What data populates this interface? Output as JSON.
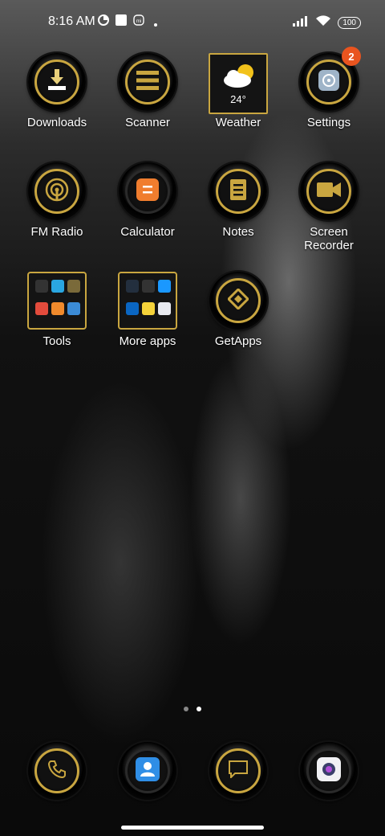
{
  "status_bar": {
    "time": "8:16 AM",
    "battery": "100"
  },
  "apps": {
    "downloads": "Downloads",
    "scanner": "Scanner",
    "weather": "Weather",
    "weather_temp": "24°",
    "settings": "Settings",
    "settings_badge": "2",
    "fm_radio": "FM Radio",
    "calculator": "Calculator",
    "notes": "Notes",
    "screen_recorder_line1": "Screen",
    "screen_recorder_line2": "Recorder",
    "tools": "Tools",
    "more_apps": "More apps",
    "getapps": "GetApps"
  },
  "page_indicator": {
    "pages": 2,
    "current": 2
  },
  "dock": [
    "phone-icon",
    "contacts-icon",
    "messages-icon",
    "camera-icon"
  ],
  "colors": {
    "gold": "#c9a640",
    "badge": "#e9541f",
    "calculator": "#f07d2e",
    "contacts": "#2f8ee6"
  }
}
